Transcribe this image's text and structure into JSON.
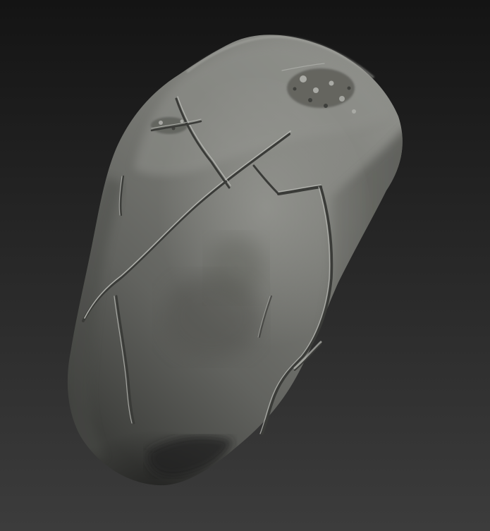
{
  "viewport": {
    "background_top": "#141414",
    "background_bottom": "#3c3c3c"
  },
  "model": {
    "object": "sculpted-rock",
    "material": "matcap-gray-clay",
    "colors": {
      "base": "#6f706b",
      "highlight": "#a3a49f",
      "midtone": "#585955",
      "shadow": "#2b2b2a",
      "crack": "#3a3b38",
      "crack_highlight": "#b9bab5"
    }
  }
}
